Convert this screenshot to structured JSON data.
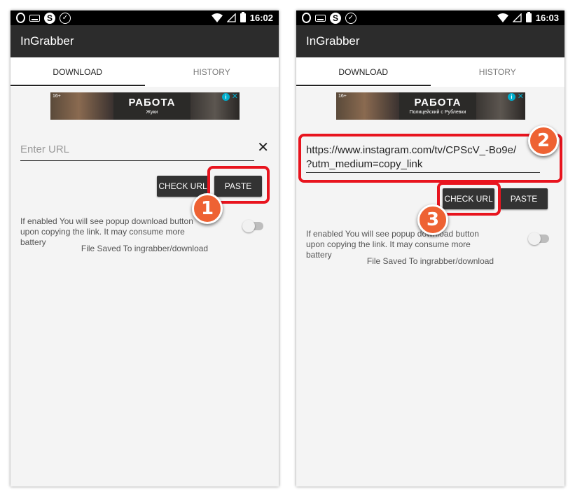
{
  "screens": [
    {
      "status_time": "16:02",
      "app_title": "InGrabber",
      "tabs": [
        "DOWNLOAD",
        "HISTORY"
      ],
      "ad": {
        "age": "16+",
        "title": "РАБОТА",
        "subtitle": "Жуки"
      },
      "url_placeholder": "Enter URL",
      "url_value": "",
      "buttons": {
        "check_url": "CHECK URL",
        "paste": "PASTE"
      },
      "toggle_text": "If enabled You will see popup download button upon copying the link. It may consume more battery",
      "saved_text": "File Saved To ingrabber/download",
      "badges": [
        "1"
      ]
    },
    {
      "status_time": "16:03",
      "app_title": "InGrabber",
      "tabs": [
        "DOWNLOAD",
        "HISTORY"
      ],
      "ad": {
        "age": "16+",
        "title": "РАБОТА",
        "subtitle": "Полицейский с Рублевки"
      },
      "url_line1": "https://www.instagram.com/tv/CPScV_-Bo9e/",
      "url_line2": "?utm_medium=copy_link",
      "buttons": {
        "check_url": "CHECK URL",
        "paste": "PASTE"
      },
      "toggle_text": "If enabled You will see popup download button upon copying the link. It may consume more battery",
      "saved_text": "File Saved To ingrabber/download",
      "badges": [
        "2",
        "3"
      ]
    }
  ],
  "colors": {
    "highlight": "#e8141e",
    "badge": "#ee6233",
    "appbar": "#2c2c2c"
  },
  "icons": [
    "opera-icon",
    "keyboard-icon",
    "shazam-icon",
    "check-circle-icon",
    "wifi-icon",
    "signal-icon",
    "battery-icon",
    "close-icon",
    "ad-info-icon"
  ]
}
